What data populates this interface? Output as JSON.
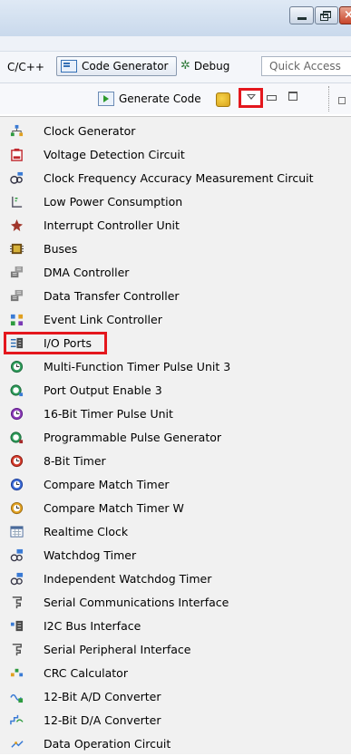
{
  "toolbar_perspectives": {
    "cpp_label": "C/C++",
    "codegen_label": "Code Generator",
    "debug_label": "Debug",
    "quick_access_placeholder": "Quick Access"
  },
  "view_toolbar": {
    "generate_code_label": "Generate Code"
  },
  "accent_colors": {
    "highlight": "#e4171d"
  },
  "menu": {
    "items": [
      {
        "label": "Clock Generator",
        "icon": "clock-generator-icon"
      },
      {
        "label": "Voltage Detection Circuit",
        "icon": "voltage-detection-icon"
      },
      {
        "label": "Clock Frequency Accuracy Measurement Circuit",
        "icon": "frequency-measurement-icon"
      },
      {
        "label": "Low Power Consumption",
        "icon": "low-power-icon"
      },
      {
        "label": "Interrupt Controller Unit",
        "icon": "interrupt-controller-icon"
      },
      {
        "label": "Buses",
        "icon": "bus-icon"
      },
      {
        "label": "DMA Controller",
        "icon": "dma-controller-icon"
      },
      {
        "label": "Data Transfer Controller",
        "icon": "data-transfer-icon"
      },
      {
        "label": "Event Link Controller",
        "icon": "event-link-icon"
      },
      {
        "label": "I/O Ports",
        "icon": "io-ports-icon"
      },
      {
        "label": "Multi-Function Timer Pulse Unit 3",
        "icon": "timer-pulse-icon"
      },
      {
        "label": "Port Output Enable 3",
        "icon": "port-output-enable-icon"
      },
      {
        "label": "16-Bit Timer Pulse Unit",
        "icon": "timer-16bit-icon"
      },
      {
        "label": "Programmable Pulse Generator",
        "icon": "pulse-generator-icon"
      },
      {
        "label": "8-Bit Timer",
        "icon": "timer-8bit-icon"
      },
      {
        "label": "Compare Match Timer",
        "icon": "compare-match-timer-icon"
      },
      {
        "label": "Compare Match Timer W",
        "icon": "compare-match-timer-w-icon"
      },
      {
        "label": "Realtime Clock",
        "icon": "realtime-clock-icon"
      },
      {
        "label": "Watchdog Timer",
        "icon": "watchdog-icon"
      },
      {
        "label": "Independent Watchdog Timer",
        "icon": "independent-watchdog-icon"
      },
      {
        "label": "Serial Communications Interface",
        "icon": "serial-comm-icon"
      },
      {
        "label": "I2C Bus Interface",
        "icon": "i2c-icon"
      },
      {
        "label": "Serial Peripheral Interface",
        "icon": "spi-icon"
      },
      {
        "label": "CRC Calculator",
        "icon": "crc-icon"
      },
      {
        "label": "12-Bit A/D Converter",
        "icon": "ad-converter-icon"
      },
      {
        "label": "12-Bit D/A Converter",
        "icon": "da-converter-icon"
      },
      {
        "label": "Data Operation Circuit",
        "icon": "data-operation-icon"
      }
    ]
  }
}
